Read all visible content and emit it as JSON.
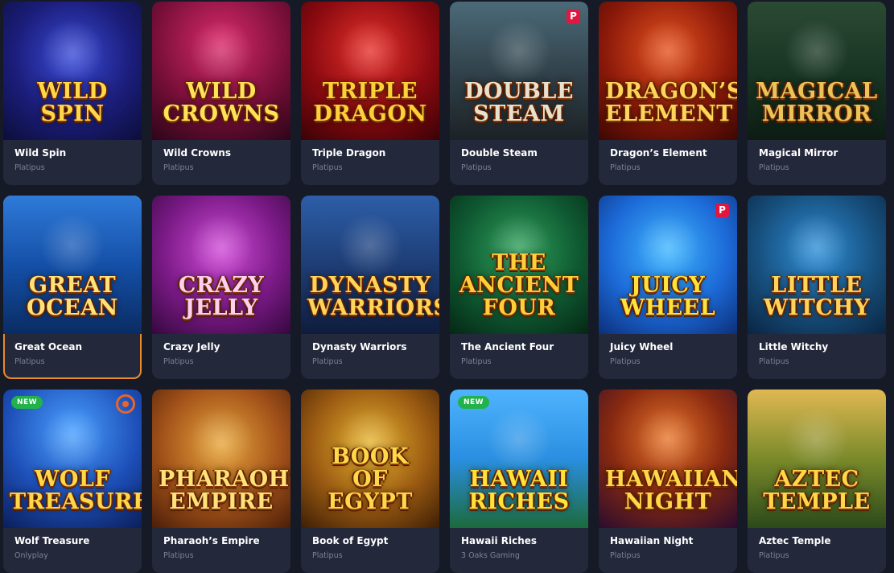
{
  "games": [
    {
      "title": "Wild Spin",
      "provider": "Platipus",
      "logo": "Wild Spin",
      "bg": "radial-gradient(circle at 50% 40%, #3a4bd8 0%, #1b1d7a 55%, #0c0e3a 100%)",
      "logo_color": "#ffd84a",
      "badge": ""
    },
    {
      "title": "Wild Crowns",
      "provider": "Platipus",
      "logo": "Wild Crowns",
      "bg": "radial-gradient(circle at 50% 30%, #d92a6a 0%, #7a0f3a 55%, #2d0518 100%)",
      "logo_color": "#ffe25a",
      "badge": ""
    },
    {
      "title": "Triple Dragon",
      "provider": "Platipus",
      "logo": "Triple Dragon",
      "bg": "radial-gradient(circle at 50% 35%, #e6302a 0%, #8a0a10 55%, #3a0206 100%)",
      "logo_color": "#ffcf3a",
      "badge": ""
    },
    {
      "title": "Double Steam",
      "provider": "Platipus",
      "logo": "Double Steam",
      "bg": "linear-gradient(180deg, #4b6a78 0%, #2f3f47 55%, #1c2226 100%)",
      "logo_color": "#e7e2cf",
      "badge": "p"
    },
    {
      "title": "Dragon’s Element",
      "provider": "Platipus",
      "logo": "Dragon’s Element",
      "bg": "radial-gradient(circle at 50% 35%, #e5521e 0%, #8d1a0a 55%, #3c0703 100%)",
      "logo_color": "#ffd45a",
      "badge": ""
    },
    {
      "title": "Magical Mirror",
      "provider": "Platipus",
      "logo": "Magical Mirror",
      "bg": "linear-gradient(180deg, #2b4a33 0%, #173322 55%, #0d1c13 100%)",
      "logo_color": "#e9c45a",
      "badge": ""
    },
    {
      "title": "Great Ocean",
      "provider": "Platipus",
      "logo": "Great Ocean",
      "bg": "linear-gradient(180deg, #2f7ad8 0%, #1450a8 50%, #0a2c63 100%)",
      "logo_color": "#ffe37a",
      "badge": "",
      "highlight": true
    },
    {
      "title": "Crazy Jelly",
      "provider": "Platipus",
      "logo": "Crazy Jelly",
      "bg": "radial-gradient(circle at 50% 40%, #d04bd8 0%, #7a1a86 55%, #35083e 100%)",
      "logo_color": "#ffd0f0",
      "badge": ""
    },
    {
      "title": "Dynasty Warriors",
      "provider": "Platipus",
      "logo": "Dynasty Warriors",
      "bg": "linear-gradient(180deg, #2d5ea8 0%, #1c3a70 55%, #0f1d3c 100%)",
      "logo_color": "#ffd45a",
      "badge": ""
    },
    {
      "title": "The Ancient Four",
      "provider": "Platipus",
      "logo": "The Ancient Four",
      "bg": "radial-gradient(circle at 50% 40%, #2fa05a 0%, #0f5a32 55%, #052714 100%)",
      "logo_color": "#ffcf3a",
      "badge": ""
    },
    {
      "title": "Juicy Wheel",
      "provider": "Platipus",
      "logo": "Juicy Wheel",
      "bg": "radial-gradient(circle at 50% 40%, #3fb7ff 0%, #1c6ad8 55%, #0c2f7a 100%)",
      "logo_color": "#ffe23a",
      "badge": "p"
    },
    {
      "title": "Little Witchy",
      "provider": "Platipus",
      "logo": "Little Witchy",
      "bg": "radial-gradient(circle at 50% 40%, #2f8fd8 0%, #17507e 55%, #0a2440 100%)",
      "logo_color": "#ffd45a",
      "badge": ""
    },
    {
      "title": "Wolf Treasure",
      "provider": "Onlyplay",
      "logo": "Wolf Treasure",
      "bg": "radial-gradient(circle at 50% 30%, #4aa0ff 0%, #1d4fb8 55%, #0b1f5a 100%)",
      "logo_color": "#ffd84a",
      "badge": "new",
      "ring": true
    },
    {
      "title": "Pharaoh’s Empire",
      "provider": "Platipus",
      "logo": "Pharaoh’s Empire",
      "bg": "radial-gradient(circle at 50% 40%, #e7a63a 0%, #a3521a 55%, #4a1e08 100%)",
      "logo_color": "#ffe27a",
      "badge": ""
    },
    {
      "title": "Book of Egypt",
      "provider": "Platipus",
      "logo": "Book of Egypt",
      "bg": "radial-gradient(circle at 50% 40%, #e8b52f 0%, #9a5a12 55%, #3d1e05 100%)",
      "logo_color": "#ffd84a",
      "badge": ""
    },
    {
      "title": "Hawaii Riches",
      "provider": "3 Oaks Gaming",
      "logo": "Hawaii Riches",
      "bg": "linear-gradient(180deg, #4fb3ff 0%, #2a8fe0 50%, #1c6a3c 100%)",
      "logo_color": "#ffe23a",
      "badge": "new"
    },
    {
      "title": "Hawaiian Night",
      "provider": "Platipus",
      "logo": "Hawaiian Night",
      "bg": "radial-gradient(circle at 50% 35%, #e8762a 0%, #8a2a10 50%, #2a0c2e 100%)",
      "logo_color": "#ffd84a",
      "badge": ""
    },
    {
      "title": "Aztec Temple",
      "provider": "Platipus",
      "logo": "Aztec Temple",
      "bg": "linear-gradient(180deg, #e0b852 0%, #7a8a2a 50%, #2c4a1a 100%)",
      "logo_color": "#ffd84a",
      "badge": ""
    }
  ],
  "badges": {
    "new_label": "NEW",
    "p_label": "P"
  }
}
